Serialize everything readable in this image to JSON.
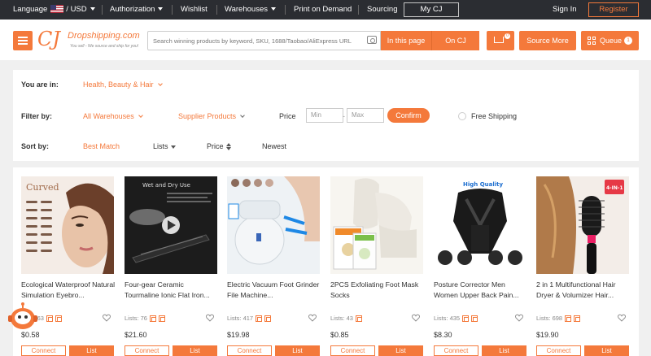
{
  "topbar": {
    "language": "Language",
    "currency": "USD",
    "authorization": "Authorization",
    "wishlist": "Wishlist",
    "warehouses": "Warehouses",
    "print_on_demand": "Print on Demand",
    "sourcing": "Sourcing",
    "my_cj": "My CJ",
    "sign_in": "Sign In",
    "register": "Register"
  },
  "header": {
    "logo_cj": "CJ",
    "logo_name": "Dropshipping.com",
    "logo_tagline": "You sell - We source and ship for you!",
    "search_placeholder": "Search winning products by keyword, SKU, 1688/Taobao/AliExpress URL",
    "in_this_page": "In this page",
    "on_cj": "On CJ",
    "cart_count": "0",
    "source_more": "Source More",
    "queue": "Queue",
    "queue_count": "1"
  },
  "filters": {
    "you_are_in_label": "You are in:",
    "category": "Health, Beauty & Hair",
    "filter_by_label": "Filter by:",
    "warehouse": "All Warehouses",
    "supplier": "Supplier Products",
    "price_label": "Price",
    "min_placeholder": "Min",
    "max_placeholder": "Max",
    "dash": "-",
    "confirm": "Confirm",
    "free_shipping": "Free Shipping",
    "sort_by_label": "Sort by:",
    "sort_best_match": "Best Match",
    "sort_lists": "Lists",
    "sort_price": "Price",
    "sort_newest": "Newest"
  },
  "products": [
    {
      "title": "Ecological Waterproof Natural Simulation Eyebro...",
      "lists": "Lists: 63",
      "price": "$0.58",
      "connect": "Connect",
      "list": "List"
    },
    {
      "title": "Four-gear Ceramic Tourmaline Ionic Flat Iron...",
      "lists": "Lists: 76",
      "price": "$21.60",
      "connect": "Connect",
      "list": "List"
    },
    {
      "title": "Electric Vacuum Foot Grinder File Machine...",
      "lists": "Lists: 417",
      "price": "$19.98",
      "connect": "Connect",
      "list": "List"
    },
    {
      "title": "2PCS Exfoliating Foot Mask Socks",
      "lists": "Lists: 43",
      "price": "$0.85",
      "connect": "Connect",
      "list": "List"
    },
    {
      "title": "Posture Corrector Men Women Upper Back Pain...",
      "lists": "Lists: 435",
      "price": "$8.30",
      "connect": "Connect",
      "list": "List"
    },
    {
      "title": "2 in 1 Multifunctional Hair Dryer & Volumizer Hair...",
      "lists": "Lists: 698",
      "price": "$19.90",
      "connect": "Connect",
      "list": "List"
    }
  ],
  "product_images": {
    "p1_text": "Curved",
    "p2_text": "Wet and Dry Use",
    "p5_text": "High Quality",
    "p6_text": "4-IN-1"
  },
  "colors": {
    "accent": "#f4793b",
    "topbar": "#2b2d32"
  },
  "icons": [
    "menu-icon",
    "camera-icon",
    "cart-icon",
    "queue-icon",
    "heart-icon",
    "play-icon",
    "robot-assistant-icon"
  ]
}
